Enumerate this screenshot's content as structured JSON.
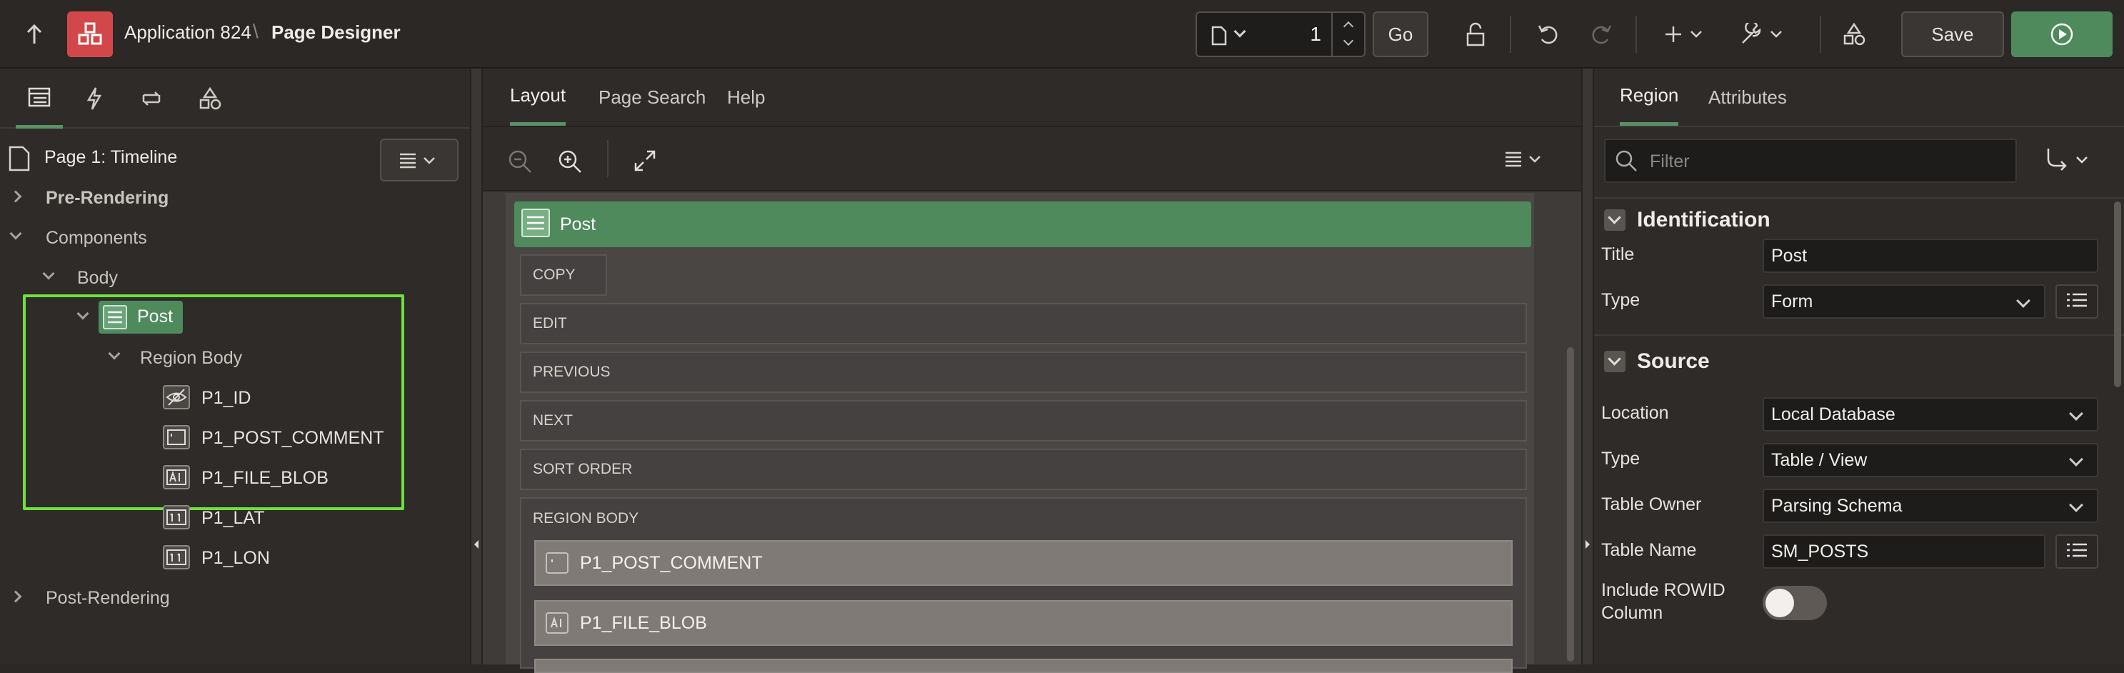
{
  "topbar": {
    "app_name": "Application 824",
    "separator": "\\",
    "page_name": "Page Designer",
    "page_number": "1",
    "go_label": "Go",
    "save_label": "Save"
  },
  "left": {
    "page_title": "Page 1: Timeline",
    "tree": {
      "pre_rendering": "Pre-Rendering",
      "components": "Components",
      "body": "Body",
      "post": "Post",
      "region_body": "Region Body",
      "items": [
        "P1_ID",
        "P1_POST_COMMENT",
        "P1_FILE_BLOB",
        "P1_LAT",
        "P1_LON"
      ],
      "post_rendering": "Post-Rendering"
    },
    "highlight_color": "#6fe13c"
  },
  "center": {
    "tabs": [
      "Layout",
      "Page Search",
      "Help"
    ],
    "region_title": "Post",
    "region_color": "#4e8a5c",
    "positions": [
      "COPY",
      "EDIT",
      "PREVIOUS",
      "NEXT",
      "SORT ORDER",
      "REGION BODY"
    ],
    "layout_items": [
      "P1_POST_COMMENT",
      "P1_FILE_BLOB"
    ]
  },
  "right": {
    "tabs": [
      "Region",
      "Attributes"
    ],
    "filter_placeholder": "Filter",
    "sections": {
      "identification": "Identification",
      "source": "Source"
    },
    "props": {
      "title_label": "Title",
      "title_value": "Post",
      "type_label": "Type",
      "type_value": "Form",
      "location_label": "Location",
      "location_value": "Local Database",
      "source_type_label": "Type",
      "source_type_value": "Table / View",
      "table_owner_label": "Table Owner",
      "table_owner_value": "Parsing Schema",
      "table_name_label": "Table Name",
      "table_name_value": "SM_POSTS",
      "rowid_label_1": "Include ROWID",
      "rowid_label_2": "Column"
    }
  },
  "colors": {
    "accent_green": "#4e8a5c",
    "app_icon_red": "#d2484a"
  }
}
